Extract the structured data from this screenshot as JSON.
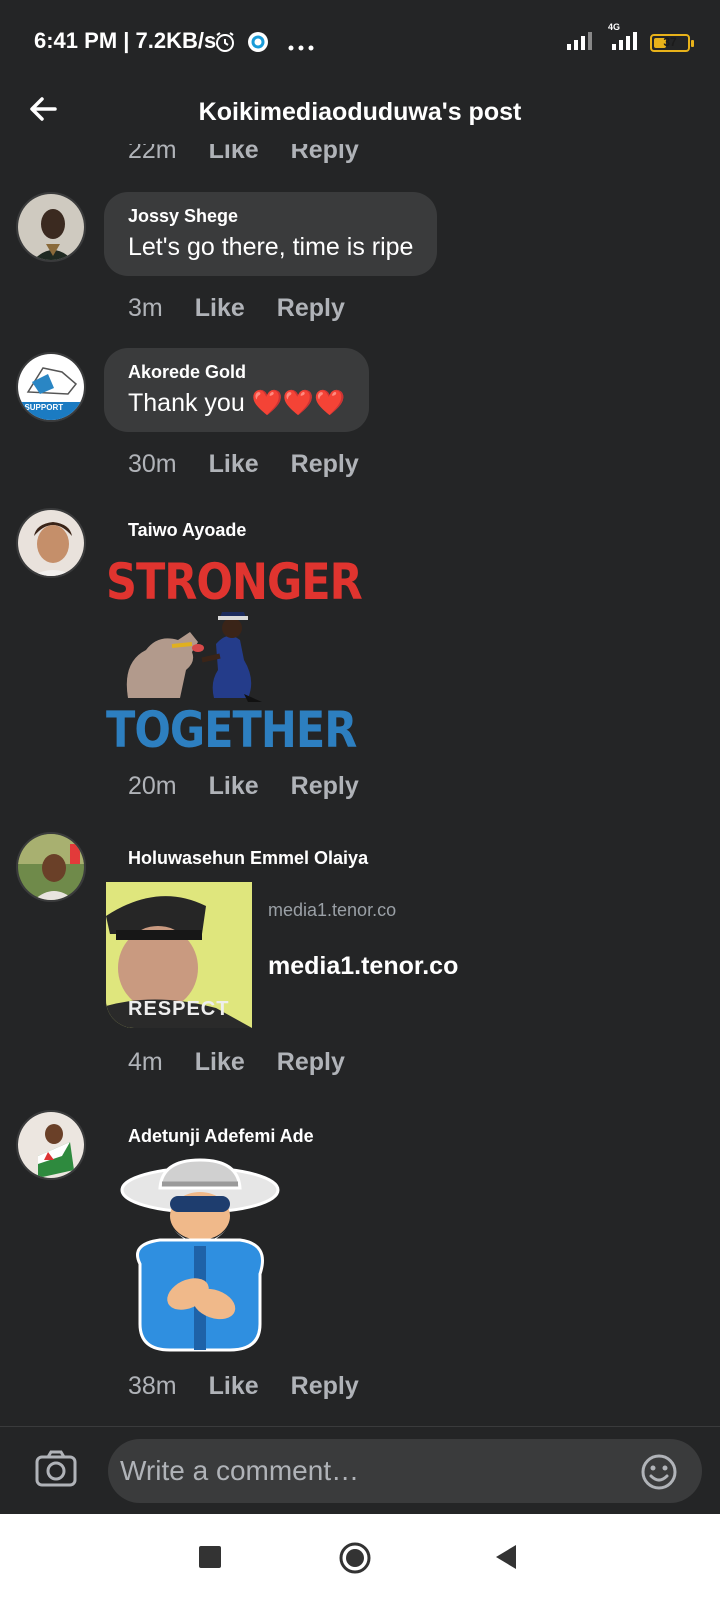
{
  "status_bar": {
    "time": "6:41 PM | 7.2KB/s",
    "network": "4G",
    "battery": "37",
    "battery_level": 0.37
  },
  "header": {
    "title": "Koikimediaoduduwa's post",
    "back_icon": "arrow-left-icon"
  },
  "partial_row": {
    "time": "22m",
    "like": "Like",
    "reply": "Reply"
  },
  "comments": [
    {
      "author": "Jossy Shege",
      "text": "Let's go there, time is ripe",
      "time": "3m",
      "like": "Like",
      "reply": "Reply"
    },
    {
      "author": "Akorede Gold",
      "text": "Thank you ❤️❤️❤️",
      "time": "30m",
      "like": "Like",
      "reply": "Reply",
      "avatar_text": "I SUPPORT"
    },
    {
      "author": "Taiwo Ayoade",
      "sticker_top": "STRONGER",
      "sticker_bottom": "TOGETHER",
      "time": "20m",
      "like": "Like",
      "reply": "Reply"
    },
    {
      "author": "Holuwasehun Emmel Olaiya",
      "link_host": "media1.tenor.co",
      "link_title": "media1.tenor.co",
      "thumb_caption": "RESPECT",
      "time": "4m",
      "like": "Like",
      "reply": "Reply"
    },
    {
      "author": "Adetunji Adefemi Ade",
      "time": "38m",
      "like": "Like",
      "reply": "Reply"
    }
  ],
  "composer": {
    "placeholder": "Write a comment…",
    "camera_icon": "camera-icon",
    "emoji_icon": "emoji-icon"
  },
  "nav": {
    "recent_icon": "square-icon",
    "home_icon": "circle-icon",
    "back_icon": "triangle-back-icon"
  },
  "colors": {
    "background": "#242526",
    "bubble": "#3a3b3c",
    "secondary_text": "#b0b3b8",
    "battery": "#e8b21a",
    "sticker_red": "#e0342f",
    "sticker_blue": "#2d7fc0"
  }
}
